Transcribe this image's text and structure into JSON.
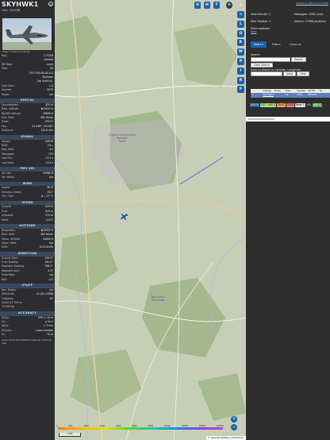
{
  "aircraft": {
    "callsign": "SKYHWK1",
    "hex_line": "Hex: C01266",
    "image_credit": "Image © Werner Verbeugt",
    "close_glyph": "×"
  },
  "info_rows": [
    {
      "k": "Reg.:",
      "v": "C-FGZD"
    },
    {
      "k": "",
      "v": "Canada"
    },
    {
      "k": "DB flags:",
      "v": "none"
    },
    {
      "k": "Type:",
      "v": "A4"
    },
    {
      "k": "",
      "v": "1973 DOUGLAS A-4"
    },
    {
      "k": "",
      "v": "Skyhawk"
    },
    {
      "k": "",
      "v": "Top Aces Inc."
    },
    {
      "k": "Type Desc.:",
      "v": "L1J"
    },
    {
      "k": "Squawk:",
      "v": "5070"
    },
    {
      "k": "Route:",
      "v": "n/a"
    }
  ],
  "sections": {
    "spatial": {
      "title": "SPATIAL",
      "rows": [
        {
          "k": "Groundspeed:",
          "v": "429 kt"
        },
        {
          "k": "Baro. altitude:",
          "v": "▼25925 ft"
        },
        {
          "k": "WGS84 altitude:",
          "v": "26800 ft"
        },
        {
          "k": "Vert. Rate:",
          "v": "-384 ft/min"
        },
        {
          "k": "Track:",
          "v": "235.5°"
        },
        {
          "k": "Pos.:",
          "v": "52.916°, 10.158°"
        },
        {
          "k": "Distance:",
          "v": "153.6 nmi"
        }
      ]
    },
    "signal": {
      "title": "SIGNAL",
      "rows": [
        {
          "k": "Source:",
          "v": "ADS-B"
        },
        {
          "k": "RSSI:",
          "v": "-23.1"
        },
        {
          "k": "Msg. Rate:",
          "v": "0.0"
        },
        {
          "k": "Messages:",
          "v": "274"
        },
        {
          "k": "Last Pos.:",
          "v": "11.5 s"
        },
        {
          "k": "Last Seen:",
          "v": "11.5 s"
        }
      ]
    },
    "fms": {
      "title": "FMS SEL",
      "rows": [
        {
          "k": "Sel. Alt.:",
          "v": "25984 ft"
        },
        {
          "k": "Sel. Head.:",
          "v": "n/a"
        }
      ]
    },
    "wind": {
      "title": "WIND",
      "rows": [
        {
          "k": "Speed:",
          "v": "38 kt"
        },
        {
          "k": "Direction (from):",
          "v": "351°"
        },
        {
          "k": "TAT / OAT:",
          "v": "-8 / -27 °C"
        }
      ]
    },
    "speed": {
      "title": "SPEED",
      "rows": [
        {
          "k": "Ground:",
          "v": "429 kt"
        },
        {
          "k": "True:",
          "v": "419 kt"
        },
        {
          "k": "Indicated:",
          "v": "274 kt"
        },
        {
          "k": "Mach:",
          "v": "0.672"
        }
      ]
    },
    "altitude": {
      "title": "ALTITUDE",
      "rows": [
        {
          "k": "Barometric:",
          "v": "▼25925 ft"
        },
        {
          "k": "Baro. Rate:",
          "v": "-384 ft/min"
        },
        {
          "k": "Geom. WGS84:",
          "v": "26800 ft"
        },
        {
          "k": "Geom. Rate:",
          "v": "n/a"
        },
        {
          "k": "QNH:",
          "v": "1013.6 hPa"
        }
      ]
    },
    "direction": {
      "title": "DIRECTION",
      "rows": [
        {
          "k": "Ground Track:",
          "v": "235.5°"
        },
        {
          "k": "True Heading:",
          "v": "240.2°"
        },
        {
          "k": "Magnetic Heading:",
          "v": "236.1°"
        },
        {
          "k": "Magnetic Decl.:",
          "v": "4.3°"
        },
        {
          "k": "Track Rate:",
          "v": "n/a"
        },
        {
          "k": "Roll:",
          "v": "-0.3"
        }
      ]
    },
    "stuff": {
      "title": "STUFF",
      "rows": [
        {
          "k": "Nav. Modes:",
          "v": "n/a"
        },
        {
          "k": "ADS-B Ver.:",
          "v": "v2 (DO-260B)"
        },
        {
          "k": "Category:",
          "v": "A2"
        },
        {
          "k": "Small (15 500 to",
          "v": ""
        },
        {
          "k": "75 000 lb)",
          "v": ""
        }
      ]
    },
    "accuracy": {
      "title": "ACCURACY",
      "rows": [
        {
          "k": "NACp:",
          "v": "EPU < 10 m"
        },
        {
          "k": "SIL:",
          "v": "≤ 1e-7"
        },
        {
          "k": "NACv:",
          "v": "< 3 m/s"
        },
        {
          "k": "NICbaro:",
          "v": "cross-checked"
        },
        {
          "k": "Rc:",
          "v": "75 m"
        }
      ]
    }
  },
  "footer_text": "Learn more about Mode S type by hovering over",
  "map": {
    "labels": [
      {
        "name": "munster-training-area",
        "text": "Truppenübungsplatz\nMunster\nNord"
      },
      {
        "name": "nature-park-sudheide",
        "text": "Naturpark\nSüdheide"
      }
    ],
    "top_controls": [
      "U",
      "H",
      "T"
    ],
    "zoom_in": "+",
    "zoom_out": "−",
    "scale_text": "5 NM",
    "legend_numbers": [
      "0",
      "500",
      "1000",
      "2000",
      "4000",
      "6000",
      "8000",
      "10000",
      "20000",
      "30000",
      "40000+"
    ],
    "attribution": "© OpenStreetMap contributors."
  },
  "strip_buttons": [
    "<",
    "L",
    "O",
    "K",
    "M",
    "P",
    "I",
    "R",
    "F"
  ],
  "right": {
    "top_link": "tar1090 on github (3.14.1793)",
    "total_aircraft": "Total Aircraft: 1",
    "with_position": "With Position: 1",
    "stats_available": "Stats available",
    "stats_link": "here",
    "messages": "Messages: 2082.2/sec",
    "history": "History: 27096 positions",
    "tabs": [
      "Search",
      "Filters",
      "Columns"
    ],
    "search_label": "Search:",
    "search_button": "Search",
    "clear_button": "Clear Search",
    "jump_label": "Jump to Airport or Latitude, Longitude:",
    "jump_button": "Jump",
    "clear2_button": "Clear",
    "table_headers": [
      "",
      "Callsign",
      "Route",
      "Type",
      "Squawk",
      "Alt (ft)",
      "Sp"
    ],
    "table_row": [
      "🇨🇦",
      "SKYHWK1",
      "",
      "A4",
      "5070",
      "▼25925",
      ""
    ],
    "sources": [
      "ADS-B",
      "UAT / ADS-R",
      "MLAT",
      "TIS-B",
      "Mode S",
      "AIS",
      "ADS-C"
    ]
  }
}
